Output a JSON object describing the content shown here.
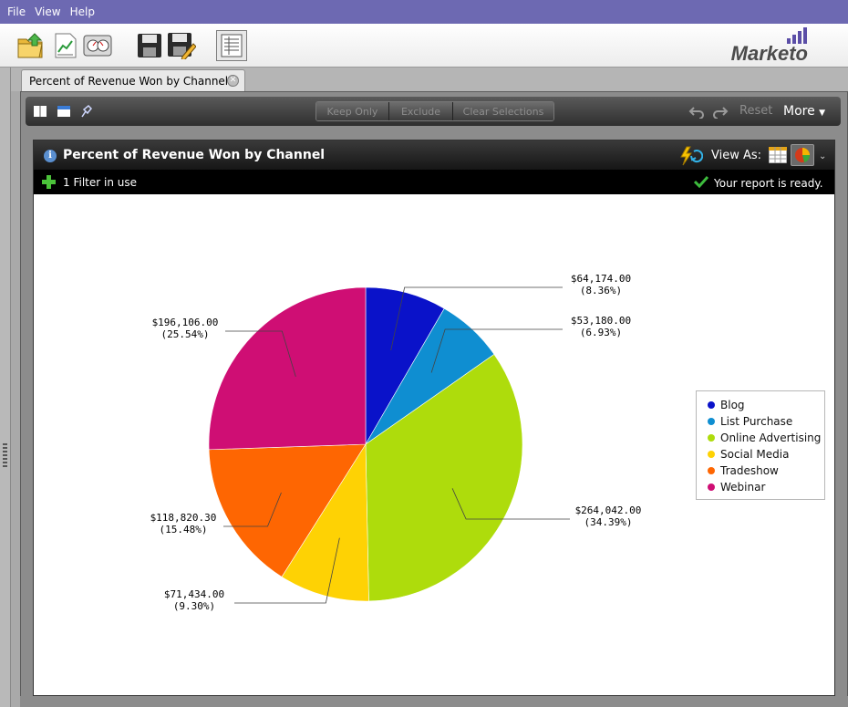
{
  "menu": {
    "items": [
      "File",
      "View",
      "Help"
    ]
  },
  "toolbar": {
    "icons": [
      "open-folder-icon",
      "line-chart-icon",
      "dashboard-icon",
      "save-icon",
      "save-as-icon",
      "report-list-icon"
    ]
  },
  "logo": {
    "text": "Marketo"
  },
  "tab": {
    "title": "Percent of Revenue Won by Channel"
  },
  "report_toolbar": {
    "keep_only": "Keep Only",
    "exclude": "Exclude",
    "clear_selections": "Clear Selections",
    "reset": "Reset",
    "more": "More"
  },
  "report": {
    "title": "Percent of Revenue Won by Channel",
    "view_as": "View As:",
    "filter_text": "1 Filter in use",
    "status_text": "Your report is ready."
  },
  "colors": {
    "Blog": "#0a12c9",
    "List Purchase": "#0f8ed1",
    "Online Advertising": "#aedc0c",
    "Social Media": "#fed204",
    "Tradeshow": "#fe6602",
    "Webinar": "#cf0e74"
  },
  "chart_data": {
    "type": "pie",
    "title": "Percent of Revenue Won by Channel",
    "legend_position": "right",
    "slices": [
      {
        "label": "Blog",
        "value": 64174.0,
        "value_text": "$64,174.00",
        "percent_text": "(8.36%)"
      },
      {
        "label": "List Purchase",
        "value": 53180.0,
        "value_text": "$53,180.00",
        "percent_text": "(6.93%)"
      },
      {
        "label": "Online Advertising",
        "value": 264042.0,
        "value_text": "$264,042.00",
        "percent_text": "(34.39%)"
      },
      {
        "label": "Social Media",
        "value": 71434.0,
        "value_text": "$71,434.00",
        "percent_text": "(9.30%)"
      },
      {
        "label": "Tradeshow",
        "value": 118820.3,
        "value_text": "$118,820.30",
        "percent_text": "(15.48%)"
      },
      {
        "label": "Webinar",
        "value": 196106.0,
        "value_text": "$196,106.00",
        "percent_text": "(25.54%)"
      }
    ]
  }
}
